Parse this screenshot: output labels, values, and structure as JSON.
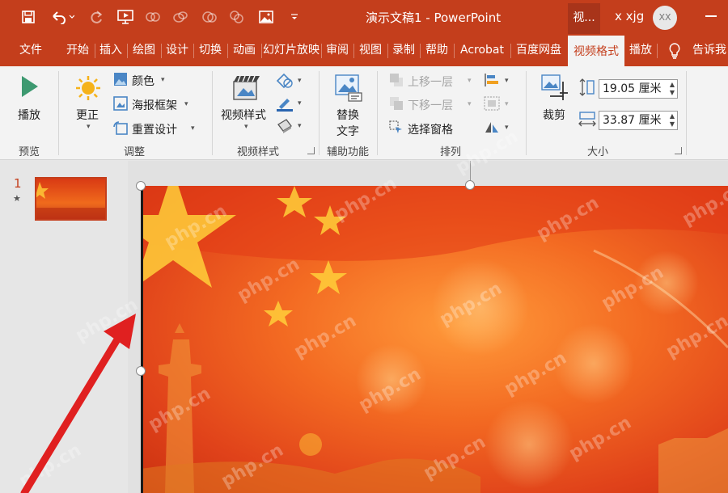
{
  "app": {
    "title": "演示文稿1  -  PowerPoint",
    "active_context": "视...",
    "user": "x xjg",
    "avatar_initials": "XX",
    "accent": "#c43e1c"
  },
  "tabs": [
    "文件",
    "开始",
    "插入",
    "绘图",
    "设计",
    "切换",
    "动画",
    "幻灯片放映",
    "审阅",
    "视图",
    "录制",
    "帮助",
    "Acrobat",
    "百度网盘",
    "视频格式",
    "播放",
    "告诉我"
  ],
  "ribbon": {
    "preview": {
      "play": "播放",
      "label": "预览"
    },
    "adjust": {
      "correct": "更正",
      "color": "颜色",
      "poster": "海报框架",
      "reset": "重置设计",
      "label": "调整"
    },
    "video_styles": {
      "styles": "视频样式",
      "label": "视频样式"
    },
    "accessibility": {
      "alt_text_1": "替换",
      "alt_text_2": "文字",
      "label": "辅助功能"
    },
    "arrange": {
      "bring_forward": "上移一层",
      "send_backward": "下移一层",
      "selection_pane": "选择窗格",
      "label": "排列"
    },
    "size": {
      "crop": "裁剪",
      "height": "19.05 厘米",
      "width": "33.87 厘米",
      "label": "大小"
    }
  },
  "slides": {
    "number": "1",
    "star": "★"
  },
  "watermark": "php.cn"
}
